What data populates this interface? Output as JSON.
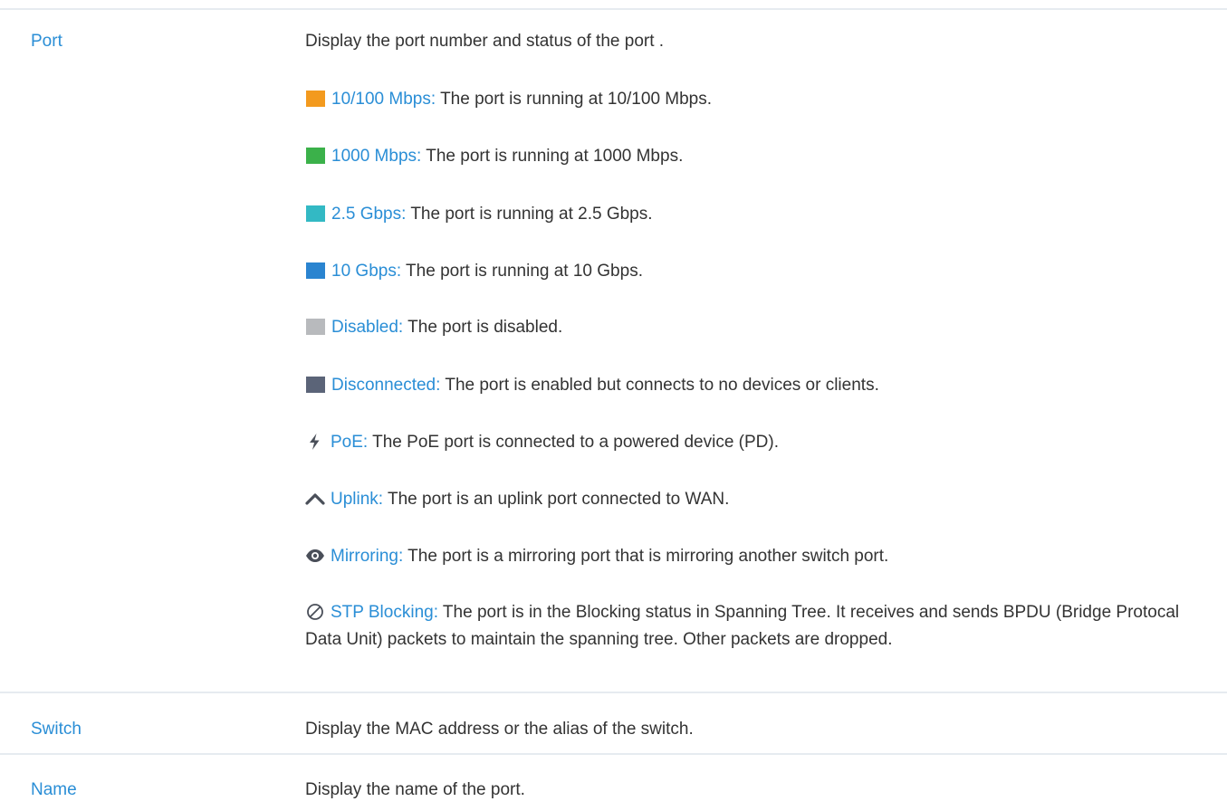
{
  "rows": [
    {
      "term": "Port",
      "description": "Display the port number and status of the port .",
      "legend": [
        {
          "icon": "swatch-orange",
          "color": "#f39a1e",
          "label": "10/100 Mbps:",
          "text": " The port is running at 10/100 Mbps."
        },
        {
          "icon": "swatch-green",
          "color": "#3bb14a",
          "label": "1000 Mbps:",
          "text": " The port is running at 1000 Mbps."
        },
        {
          "icon": "swatch-teal",
          "color": "#33b9c4",
          "label": "2.5 Gbps:",
          "text": " The port is running at 2.5 Gbps."
        },
        {
          "icon": "swatch-blue",
          "color": "#2a84d0",
          "label": "10 Gbps:",
          "text": " The port is running at 10 Gbps."
        },
        {
          "icon": "swatch-gray",
          "color": "#b8babd",
          "label": "Disabled:",
          "text": " The port is disabled."
        },
        {
          "icon": "swatch-slate",
          "color": "#5b6478",
          "label": "Disconnected:",
          "text": " The port is enabled but connects to no devices or clients."
        },
        {
          "icon": "lightning-icon",
          "label": "PoE:",
          "text": " The PoE port is connected to a powered device (PD)."
        },
        {
          "icon": "chevron-up-icon",
          "label": "Uplink:",
          "text": " The port is an uplink port connected to WAN."
        },
        {
          "icon": "eye-icon",
          "label": "Mirroring:",
          "text": " The port is a mirroring port that is mirroring another switch port."
        },
        {
          "icon": "blocked-icon",
          "label": "STP Blocking:",
          "text": " The port is in the Blocking status in Spanning Tree. It receives and sends BPDU (Bridge Protocal Data Unit) packets to maintain the spanning tree. Other packets are dropped."
        }
      ]
    },
    {
      "term": "Switch",
      "description": "Display the MAC address or the alias of the switch."
    },
    {
      "term": "Name",
      "description": "Display the name of the port."
    }
  ],
  "colors": {
    "term": "#2a8ed6",
    "text": "#333333",
    "rule": "#e6ebf0"
  }
}
